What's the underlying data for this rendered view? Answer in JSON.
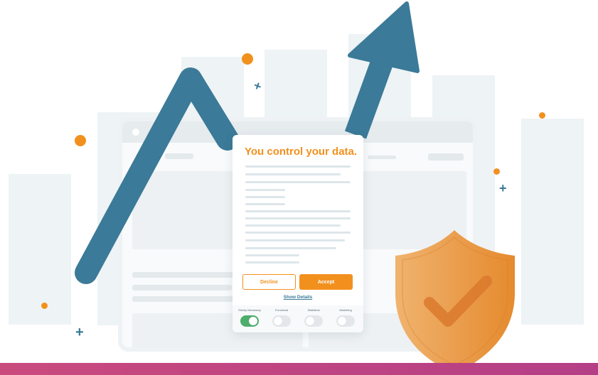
{
  "modal": {
    "title": "You control your data.",
    "decline_label": "Decline",
    "accept_label": "Accept",
    "details_label": "Show Details"
  },
  "toggles": [
    {
      "label": "Strictly Necessary",
      "on": true
    },
    {
      "label": "Functional",
      "on": false
    },
    {
      "label": "Statistical",
      "on": false
    },
    {
      "label": "Marketing",
      "on": false
    }
  ],
  "colors": {
    "accent": "#f2901e",
    "arrow": "#3b7a98",
    "toggle_on": "#4cae6a",
    "shield": "#e9974a",
    "bottom_band": "#c94b7e"
  },
  "icons": [
    "trend-arrow-icon",
    "shield-check-icon",
    "plus-sparkle-icon"
  ]
}
